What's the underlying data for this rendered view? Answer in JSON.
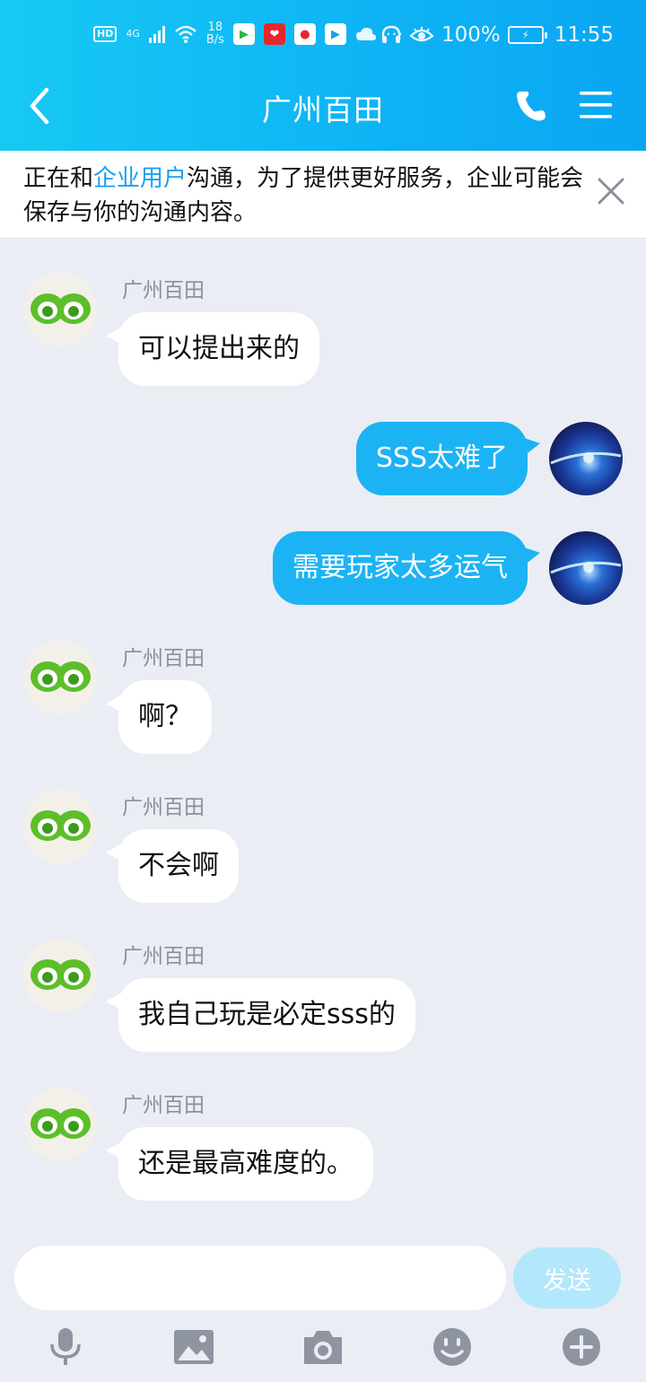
{
  "status_bar": {
    "hd": "HD",
    "network": "4G",
    "speed_value": "18",
    "speed_unit": "B/s",
    "battery": "100%",
    "time": "11:55",
    "more": "···"
  },
  "header": {
    "title": "广州百田"
  },
  "notice": {
    "text_before": "正在和",
    "link_text": "企业用户",
    "text_after": "沟通，为了提供更好服务，企业可能会保存与你的沟通内容。"
  },
  "messages": [
    {
      "sender": "广州百田",
      "text": "可以提出来的"
    },
    {
      "text": "SSS太难了"
    },
    {
      "text": "需要玩家太多运气"
    },
    {
      "sender": "广州百田",
      "text": "啊？"
    },
    {
      "sender": "广州百田",
      "text": "不会啊"
    },
    {
      "sender": "广州百田",
      "text": "我自己玩是必定sss的"
    },
    {
      "sender": "广州百田",
      "text": "还是最高难度的。"
    }
  ],
  "input": {
    "value": "",
    "send_label": "发送"
  },
  "colors": {
    "header": "#0fb4f5",
    "outgoing_bubble": "#1cb3f4",
    "incoming_bubble": "#ffffff",
    "background": "#eaedf4",
    "send_button_disabled": "#b3e7fb",
    "link": "#1aa0ee"
  },
  "toolbar_icons": [
    "microphone-icon",
    "image-icon",
    "camera-icon",
    "emoji-icon",
    "plus-icon"
  ]
}
